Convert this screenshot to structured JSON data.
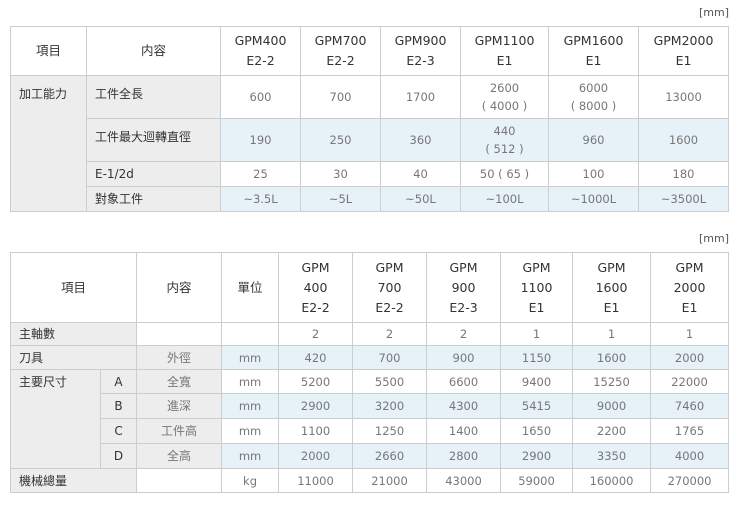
{
  "table1": {
    "unit": "[mm]",
    "header": {
      "item": "項目",
      "content": "内容",
      "models": [
        {
          "line1": "GPM400",
          "line2": "E2-2"
        },
        {
          "line1": "GPM700",
          "line2": "E2-2"
        },
        {
          "line1": "GPM900",
          "line2": "E2-3"
        },
        {
          "line1": "GPM1100",
          "line2": "E1"
        },
        {
          "line1": "GPM1600",
          "line2": "E1"
        },
        {
          "line1": "GPM2000",
          "line2": "E1"
        }
      ]
    },
    "group": "加工能力",
    "rows": [
      {
        "label": "工件全長",
        "values": [
          {
            "main": "600"
          },
          {
            "main": "700"
          },
          {
            "main": "1700"
          },
          {
            "main": "2600",
            "sub": "( 4000 )"
          },
          {
            "main": "6000",
            "sub": "( 8000 )"
          },
          {
            "main": "13000"
          }
        ]
      },
      {
        "label": "工件最大迴轉直徑",
        "values": [
          {
            "main": "190"
          },
          {
            "main": "250"
          },
          {
            "main": "360"
          },
          {
            "main": "440",
            "sub": "( 512 )"
          },
          {
            "main": "960"
          },
          {
            "main": "1600"
          }
        ]
      },
      {
        "label": "E-1/2d",
        "values": [
          {
            "main": "25"
          },
          {
            "main": "30"
          },
          {
            "main": "40"
          },
          {
            "main": "50 ( 65 )"
          },
          {
            "main": "100"
          },
          {
            "main": "180"
          }
        ]
      },
      {
        "label": "對象工件",
        "values": [
          {
            "main": "~3.5L"
          },
          {
            "main": "~5L"
          },
          {
            "main": "~50L"
          },
          {
            "main": "~100L"
          },
          {
            "main": "~1000L"
          },
          {
            "main": "~3500L"
          }
        ]
      }
    ]
  },
  "table2": {
    "unit": "[mm]",
    "header": {
      "item": "項目",
      "content": "内容",
      "unit_col": "單位",
      "models": [
        {
          "line1": "GPM",
          "line2": "400",
          "line3": "E2-2"
        },
        {
          "line1": "GPM",
          "line2": "700",
          "line3": "E2-2"
        },
        {
          "line1": "GPM",
          "line2": "900",
          "line3": "E2-3"
        },
        {
          "line1": "GPM",
          "line2": "1100",
          "line3": "E1"
        },
        {
          "line1": "GPM",
          "line2": "1600",
          "line3": "E1"
        },
        {
          "line1": "GPM",
          "line2": "2000",
          "line3": "E1"
        }
      ]
    },
    "spindle": {
      "label": "主軸數",
      "values": [
        "2",
        "2",
        "2",
        "1",
        "1",
        "1"
      ]
    },
    "tool": {
      "label": "刀具",
      "content": "外徑",
      "unit": "mm",
      "values": [
        "420",
        "700",
        "900",
        "1150",
        "1600",
        "2000"
      ]
    },
    "dimensions": {
      "label": "主要尺寸",
      "rows": [
        {
          "key": "A",
          "content": "全寬",
          "unit": "mm",
          "values": [
            "5200",
            "5500",
            "6600",
            "9400",
            "15250",
            "22000"
          ]
        },
        {
          "key": "B",
          "content": "進深",
          "unit": "mm",
          "values": [
            "2900",
            "3200",
            "4300",
            "5415",
            "9000",
            "7460"
          ]
        },
        {
          "key": "C",
          "content": "工件高",
          "unit": "mm",
          "values": [
            "1100",
            "1250",
            "1400",
            "1650",
            "2200",
            "1765"
          ]
        },
        {
          "key": "D",
          "content": "全高",
          "unit": "mm",
          "values": [
            "2000",
            "2660",
            "2800",
            "2900",
            "3350",
            "4000"
          ]
        }
      ]
    },
    "weight": {
      "label": "機械總量",
      "unit": "kg",
      "values": [
        "11000",
        "21000",
        "43000",
        "59000",
        "160000",
        "270000"
      ]
    }
  }
}
